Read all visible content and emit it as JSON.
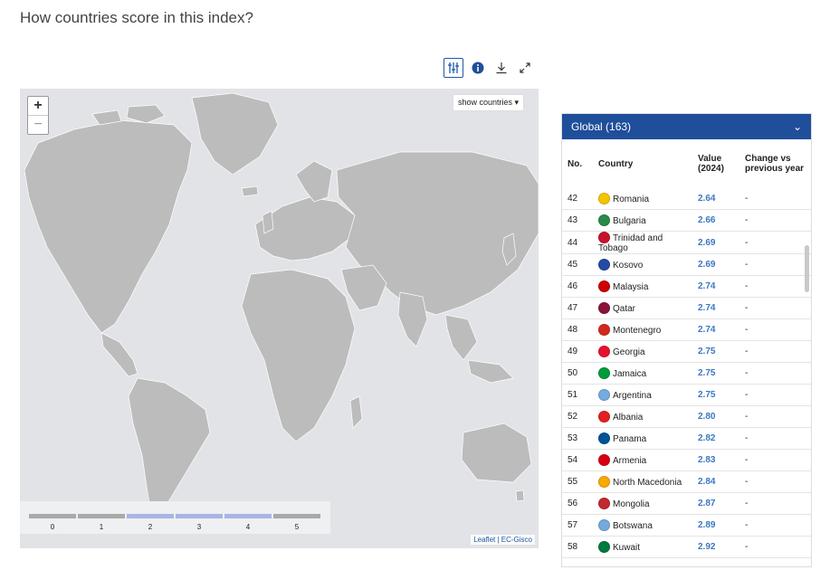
{
  "page": {
    "title": "How countries score in this index?"
  },
  "toolbar": {
    "filter_icon": "sliders-icon",
    "info_icon": "info-icon",
    "download_icon": "download-icon",
    "expand_icon": "expand-icon"
  },
  "map": {
    "zoom_in": "+",
    "zoom_out": "−",
    "show_countries": "show countries ▾",
    "attribution": "Leaflet | EC-Gisco",
    "legend": {
      "labels": [
        "0",
        "1",
        "2",
        "3",
        "4",
        "5"
      ],
      "highlighted_range": [
        2,
        5
      ],
      "colors": {
        "gray": "#a9a9a9",
        "blue": "#a7b5e3"
      }
    }
  },
  "panel": {
    "header": "Global (163)",
    "chevron": "⌄",
    "columns": [
      "No.",
      "Country",
      "Value (2024)",
      "Change vs previous year"
    ],
    "rows": [
      {
        "no": "42",
        "country": "Romania",
        "value": "2.64",
        "change": "-",
        "flag": "#f5c400"
      },
      {
        "no": "43",
        "country": "Bulgaria",
        "value": "2.66",
        "change": "-",
        "flag": "#2a8a4a"
      },
      {
        "no": "44",
        "country": "Trinidad and Tobago",
        "value": "2.69",
        "change": "-",
        "flag": "#c8102e"
      },
      {
        "no": "45",
        "country": "Kosovo",
        "value": "2.69",
        "change": "-",
        "flag": "#244aa5"
      },
      {
        "no": "46",
        "country": "Malaysia",
        "value": "2.74",
        "change": "-",
        "flag": "#cc0001"
      },
      {
        "no": "47",
        "country": "Qatar",
        "value": "2.74",
        "change": "-",
        "flag": "#8a1538"
      },
      {
        "no": "48",
        "country": "Montenegro",
        "value": "2.74",
        "change": "-",
        "flag": "#d3281d"
      },
      {
        "no": "49",
        "country": "Georgia",
        "value": "2.75",
        "change": "-",
        "flag": "#e8112d"
      },
      {
        "no": "50",
        "country": "Jamaica",
        "value": "2.75",
        "change": "-",
        "flag": "#009b3a"
      },
      {
        "no": "51",
        "country": "Argentina",
        "value": "2.75",
        "change": "-",
        "flag": "#74acdf"
      },
      {
        "no": "52",
        "country": "Albania",
        "value": "2.80",
        "change": "-",
        "flag": "#e41e20"
      },
      {
        "no": "53",
        "country": "Panama",
        "value": "2.82",
        "change": "-",
        "flag": "#005293"
      },
      {
        "no": "54",
        "country": "Armenia",
        "value": "2.83",
        "change": "-",
        "flag": "#d90012"
      },
      {
        "no": "55",
        "country": "North Macedonia",
        "value": "2.84",
        "change": "-",
        "flag": "#f8a900"
      },
      {
        "no": "56",
        "country": "Mongolia",
        "value": "2.87",
        "change": "-",
        "flag": "#c4272f"
      },
      {
        "no": "57",
        "country": "Botswana",
        "value": "2.89",
        "change": "-",
        "flag": "#75aadb"
      },
      {
        "no": "58",
        "country": "Kuwait",
        "value": "2.92",
        "change": "-",
        "flag": "#007a3d"
      }
    ]
  }
}
